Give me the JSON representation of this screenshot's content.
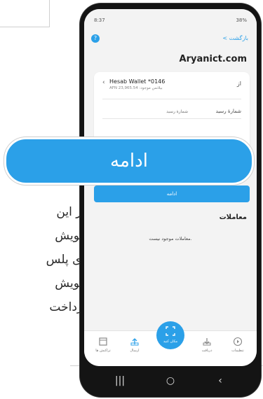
{
  "background": {
    "lines": [
      "در این",
      "خویش",
      "دی پلس",
      "خویش",
      "پرداخت"
    ]
  },
  "status": {
    "time": "8:37",
    "right": "38%"
  },
  "header": {
    "back_label": "< بازگشت",
    "help_label": "?"
  },
  "page_title": "Aryanict.com",
  "form": {
    "from_label": "از",
    "account_name": "Hesab Wallet *0146",
    "account_balance": "AFN 23,965.54 :بیلانس موجود",
    "receipt_label": "شمارهٔ رسید",
    "receipt_placeholder": "شمارهٔ رسید",
    "submit_label": "ادامه"
  },
  "transactions": {
    "title": "معاملات",
    "empty": "معاملات موجود نیست."
  },
  "bottom_nav": {
    "items": [
      "تراکنش ها",
      "ارسال",
      "دریافت",
      "تنظیمات"
    ],
    "scan_label": "مکان کنید"
  },
  "overlay_label": "ادامه",
  "colors": {
    "accent": "#2ba0e8",
    "phone": "#141414",
    "screen_bg": "#f3f3f3"
  }
}
